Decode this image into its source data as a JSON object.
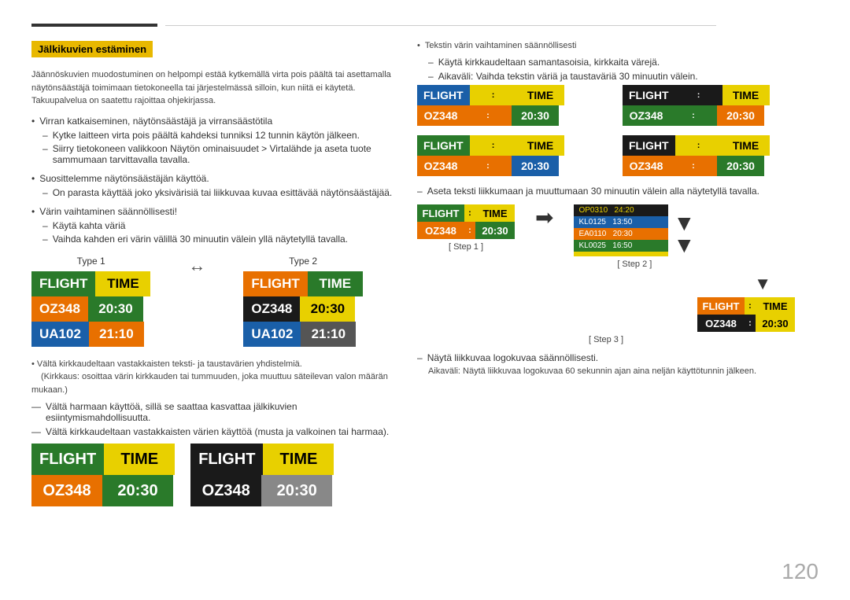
{
  "page": {
    "number": "120"
  },
  "header": {
    "section_title": "Jälkikuvien estäminen"
  },
  "left": {
    "intro_text": "Jäännöskuvien muodostuminen on helpompi estää kytkemällä virta pois päältä tai asettamalla näytönsäästäjä toimimaan tietokoneella tai järjestelmässä silloin, kun niitä ei käytetä. Takuupalvelua on saatettu rajoittaa ohjekirjassa.",
    "bullets": [
      {
        "text": "Virran katkaiseminen, näytönsäästäjä ja virransäästötila",
        "dashes": [
          "Kytke laitteen virta pois päältä kahdeksi tunniksi 12 tunnin käytön jälkeen.",
          "Siirry tietokoneen valikkoon Näytön ominaisuudet > Virtalähde ja aseta tuote sammumaan tarvittavalla tavalla."
        ]
      },
      {
        "text": "Suosittelemme näytönsäästäjän käyttöä.",
        "dashes": [
          "On parasta käyttää joko yksivärisiä tai liikkuvaa kuvaa esittävää näytönsäästäjää."
        ]
      },
      {
        "text": "Värin vaihtaminen säännöllisesti!",
        "dashes": [
          "Käytä kahta väriä",
          "Vaihda kahden eri värin välillä 30 minuutin välein yllä näytetyllä tavalla."
        ]
      }
    ],
    "type1_label": "Type 1",
    "type2_label": "Type 2",
    "board1": {
      "header": [
        "FLIGHT",
        "TIME"
      ],
      "rows": [
        [
          "OZ348",
          "20:30"
        ],
        [
          "UA102",
          "21:10"
        ]
      ]
    },
    "board2": {
      "header": [
        "FLIGHT",
        "TIME"
      ],
      "rows": [
        [
          "OZ348",
          "20:30"
        ],
        [
          "UA102",
          "21:10"
        ]
      ]
    },
    "note1": "Vältä kirkkaudeltaan vastakkaisten teksti- ja taustavärien yhdistelmiä.",
    "note1_paren": "(Kirkkaus: osoittaa värin kirkkauden tai tummuuden, joka muuttuu säteilevan valon määrän mukaan.)",
    "note2": "Vältä harmaan käyttöä, sillä se saattaa kasvattaa jälkikuvien esiintymismahdollisuutta.",
    "note3": "Vältä kirkkaudeltaan vastakkaisten värien käyttöä (musta ja valkoinen tai harmaa).",
    "bottom_board1": {
      "header_colors": [
        "green",
        "yellow"
      ],
      "header": [
        "FLIGHT",
        "TIME"
      ],
      "row": [
        "OZ348",
        "20:30"
      ]
    },
    "bottom_board2": {
      "header": [
        "FLIGHT",
        "TIME"
      ],
      "row": [
        "OZ348",
        "20:30"
      ]
    }
  },
  "right": {
    "bullet1": "Tekstin värin vaihtaminen säännöllisesti",
    "dash1": "Käytä kirkkaudeltaan samantasoisia, kirkkaita värejä.",
    "dash2": "Aikaväli: Vaihda tekstin väriä ja taustaväriä 30 minuutin välein.",
    "color_boards": [
      {
        "id": "rb1",
        "header": [
          "FLIGHT",
          "TIME"
        ],
        "row": [
          "OZ348",
          "20:30"
        ],
        "h_colors": [
          "blue",
          "yellow"
        ],
        "r_colors": [
          "orange",
          "green"
        ]
      },
      {
        "id": "rb2",
        "header": [
          "FLIGHT",
          "TIME"
        ],
        "row": [
          "OZ348",
          "20:30"
        ],
        "h_colors": [
          "dark",
          "yellow"
        ],
        "r_colors": [
          "green",
          "orange"
        ]
      },
      {
        "id": "rb3",
        "header": [
          "FLIGHT",
          "TIME"
        ],
        "row": [
          "OZ348",
          "20:30"
        ],
        "h_colors": [
          "green",
          "yellow"
        ],
        "r_colors": [
          "orange",
          "blue"
        ]
      },
      {
        "id": "rb4",
        "header": [
          "FLIGHT",
          "TIME"
        ],
        "row": [
          "OZ348",
          "20:30"
        ],
        "h_colors": [
          "dark",
          "yellow"
        ],
        "r_colors": [
          "orange",
          "green"
        ]
      }
    ],
    "dash3": "Aseta teksti liikkumaan ja muuttumaan 30 minuutin välein alla näytetyllä tavalla.",
    "step1_label": "[ Step 1 ]",
    "step2_label": "[ Step 2 ]",
    "step3_label": "[ Step 3 ]",
    "step1_board": {
      "header": [
        "FLIGHT",
        "TIME"
      ],
      "row": [
        "OZ348",
        "20:30"
      ]
    },
    "step2_board": {
      "rows": [
        "OP0310  24:20",
        "KL0125  13:50",
        "EA0110  20:30",
        "KL0025  16:50"
      ]
    },
    "step3_board": {
      "header": [
        "FLIGHT",
        "TIME"
      ],
      "row": [
        "OZ348",
        "20:30"
      ]
    },
    "note_dash1": "Näytä liikkuvaa logokuvaa säännöllisesti.",
    "note_dash2": "Aikaväli: Näytä liikkuvaa logokuvaa 60 sekunnin ajan aina neljän käyttötunnin jälkeen."
  }
}
